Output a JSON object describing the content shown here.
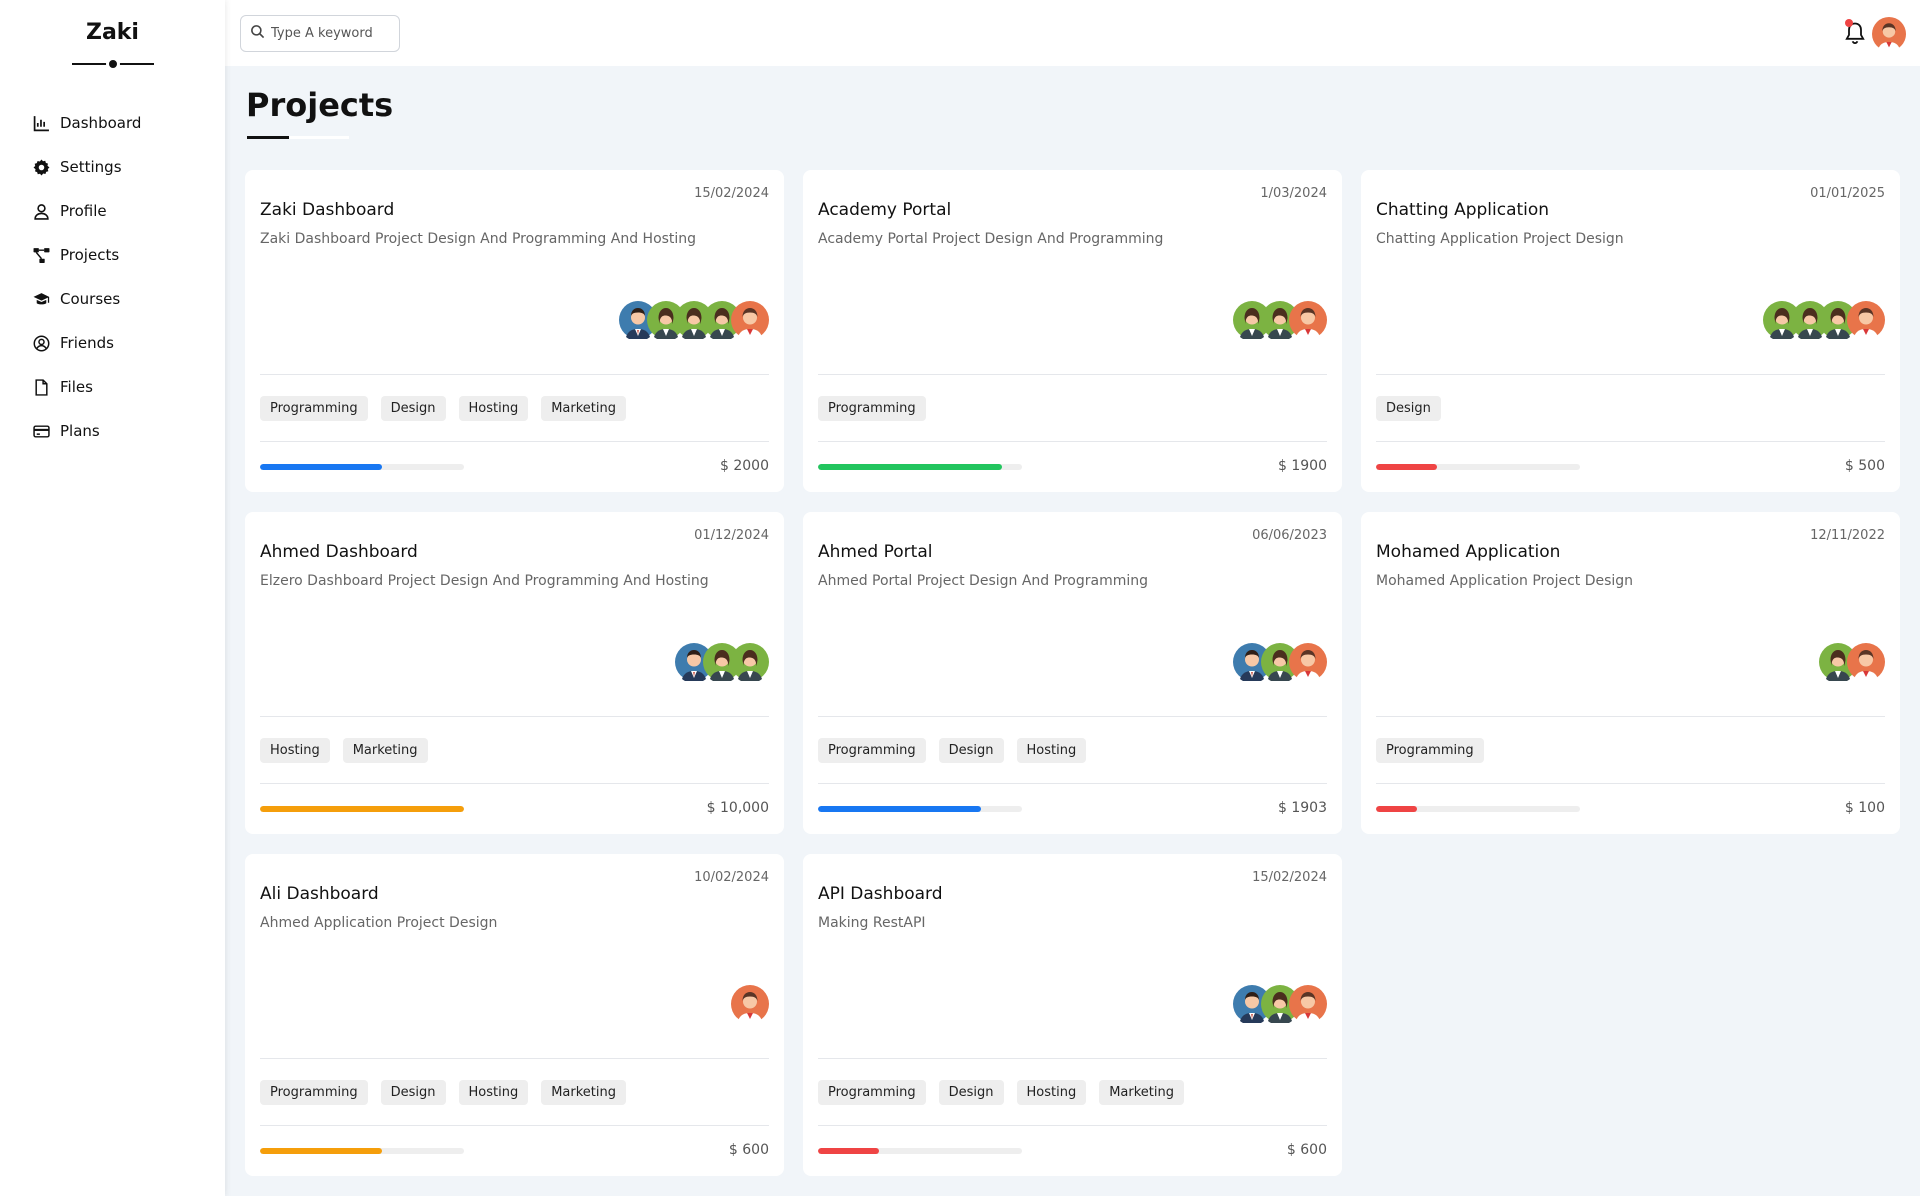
{
  "sidebar": {
    "brand": "Zaki",
    "items": [
      {
        "label": "Dashboard",
        "icon": "chart-icon"
      },
      {
        "label": "Settings",
        "icon": "gear-icon"
      },
      {
        "label": "Profile",
        "icon": "user-icon"
      },
      {
        "label": "Projects",
        "icon": "diagram-icon"
      },
      {
        "label": "Courses",
        "icon": "graduation-cap-icon"
      },
      {
        "label": "Friends",
        "icon": "user-circle-icon"
      },
      {
        "label": "Files",
        "icon": "file-icon"
      },
      {
        "label": "Plans",
        "icon": "credit-card-icon"
      }
    ]
  },
  "header": {
    "search_placeholder": "Type A keyword",
    "notification_dot_color": "#ef4444"
  },
  "main": {
    "title": "Projects"
  },
  "colors": {
    "blue": "#1877f2",
    "green": "#22c55e",
    "red": "#ef4444",
    "orange": "#f59e0b"
  },
  "projects": [
    {
      "date": "15/02/2024",
      "title": "Zaki Dashboard",
      "description": "Zaki Dashboard Project Design And Programming And Hosting",
      "team": [
        "blue",
        "green",
        "green",
        "green",
        "orange"
      ],
      "tags": [
        "Programming",
        "Design",
        "Hosting",
        "Marketing"
      ],
      "progress": 0.6,
      "progress_color": "#1877f2",
      "price": "$ 2000"
    },
    {
      "date": "1/03/2024",
      "title": "Academy Portal",
      "description": "Academy Portal Project Design And Programming",
      "team": [
        "green",
        "green",
        "orange"
      ],
      "tags": [
        "Programming"
      ],
      "progress": 0.9,
      "progress_color": "#22c55e",
      "price": "$ 1900"
    },
    {
      "date": "01/01/2025",
      "title": "Chatting Application",
      "description": "Chatting Application Project Design",
      "team": [
        "green",
        "green",
        "green",
        "orange"
      ],
      "tags": [
        "Design"
      ],
      "progress": 0.3,
      "progress_color": "#ef4444",
      "price": "$ 500"
    },
    {
      "date": "01/12/2024",
      "title": "Ahmed Dashboard",
      "description": "Elzero Dashboard Project Design And Programming And Hosting",
      "team": [
        "blue",
        "green",
        "green"
      ],
      "tags": [
        "Hosting",
        "Marketing"
      ],
      "progress": 1.0,
      "progress_color": "#f59e0b",
      "price": "$ 10,000"
    },
    {
      "date": "06/06/2023",
      "title": "Ahmed Portal",
      "description": "Ahmed Portal Project Design And Programming",
      "team": [
        "blue",
        "green",
        "orange"
      ],
      "tags": [
        "Programming",
        "Design",
        "Hosting"
      ],
      "progress": 0.8,
      "progress_color": "#1877f2",
      "price": "$ 1903"
    },
    {
      "date": "12/11/2022",
      "title": "Mohamed Application",
      "description": "Mohamed Application Project Design",
      "team": [
        "green",
        "orange"
      ],
      "tags": [
        "Programming"
      ],
      "progress": 0.2,
      "progress_color": "#ef4444",
      "price": "$ 100"
    },
    {
      "date": "10/02/2024",
      "title": "Ali Dashboard",
      "description": "Ahmed Application Project Design",
      "team": [
        "orange"
      ],
      "tags": [
        "Programming",
        "Design",
        "Hosting",
        "Marketing"
      ],
      "progress": 0.6,
      "progress_color": "#f59e0b",
      "price": "$ 600"
    },
    {
      "date": "15/02/2024",
      "title": "API Dashboard",
      "description": "Making RestAPI",
      "team": [
        "blue",
        "green",
        "orange"
      ],
      "tags": [
        "Programming",
        "Design",
        "Hosting",
        "Marketing"
      ],
      "progress": 0.3,
      "progress_color": "#ef4444",
      "price": "$ 600"
    }
  ]
}
